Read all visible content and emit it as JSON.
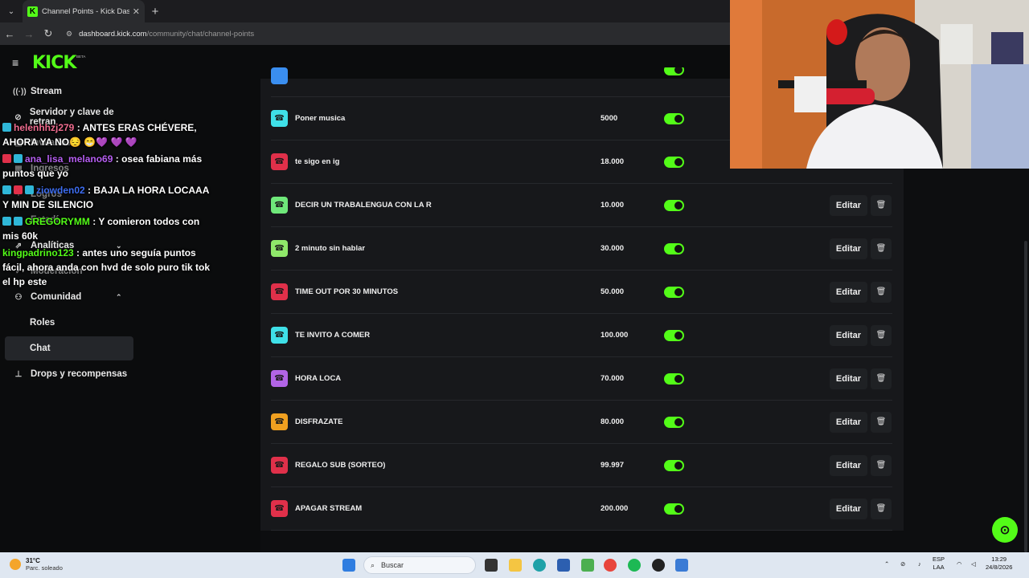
{
  "browser": {
    "tab_title": "Channel Points - Kick Dashboar",
    "tab_close": "✕",
    "new_tab": "+",
    "url_host": "dashboard.kick.com",
    "url_path": "/community/chat/channel-points"
  },
  "sidebar": {
    "logo": "KICK",
    "beta": "BETA",
    "items": [
      {
        "label": "Stream",
        "icon": "stream-icon"
      },
      {
        "label": "Servidor y clave de retran",
        "icon": "link-icon"
      },
      {
        "label": "Invitados",
        "icon": "guests-icon"
      },
      {
        "label": "Ingresos",
        "icon": "income-icon"
      },
      {
        "label": "Logros",
        "icon": "trophy-icon"
      },
      {
        "label": "Estadí",
        "icon": "stats-icon"
      },
      {
        "label": "Analíticas",
        "icon": "analytics-icon"
      },
      {
        "label": "Moderación",
        "icon": "moderation-icon"
      },
      {
        "label": "Comunidad",
        "icon": "community-icon"
      },
      {
        "label": "Roles",
        "icon": ""
      },
      {
        "label": "Chat",
        "icon": ""
      },
      {
        "label": "Drops y recompensas",
        "icon": "drops-icon"
      }
    ]
  },
  "chat_overlay": [
    {
      "user": "helenhhzj279",
      "text": ": ANTES ERAS CHÉVERE, AHORA YA NO😔 😁💜 💜 💜"
    },
    {
      "user": "ana_lisa_melano69",
      "text": ": osea fabiana más puntos que yo"
    },
    {
      "user": "ziowden02",
      "text": ": BAJA LA HORA LOCAAA Y MIN DE SILENCIO"
    },
    {
      "user": "GREGORYMM",
      "text": ": Y comieron todos con mis 60k"
    },
    {
      "user": "kingpadrino123",
      "text": ": antes uno seguía puntos fácil, ahora anda con hvd de solo puro tik tok el hp este"
    }
  ],
  "rewards": [
    {
      "name": "Poner musica",
      "cost": "5000",
      "color": "#3fe0e8",
      "enabled": true
    },
    {
      "name": "te sigo en ig",
      "cost": "18.000",
      "color": "#e0304a",
      "enabled": true
    },
    {
      "name": "DECIR UN TRABALENGUA CON LA R",
      "cost": "10.000",
      "color": "#6fe87a",
      "enabled": true
    },
    {
      "name": "2 minuto sin hablar",
      "cost": "30.000",
      "color": "#8fe86a",
      "enabled": true
    },
    {
      "name": "TIME OUT POR 30 MINUTOS",
      "cost": "50.000",
      "color": "#e0304a",
      "enabled": true
    },
    {
      "name": "TE INVITO A COMER",
      "cost": "100.000",
      "color": "#3fe0e8",
      "enabled": true
    },
    {
      "name": "HORA LOCA",
      "cost": "70.000",
      "color": "#b264e6",
      "enabled": true
    },
    {
      "name": "DISFRAZATE",
      "cost": "80.000",
      "color": "#f0a020",
      "enabled": true
    },
    {
      "name": "REGALO SUB (SORTEO)",
      "cost": "99.997",
      "color": "#e0304a",
      "enabled": true
    },
    {
      "name": "APAGAR STREAM",
      "cost": "200.000",
      "color": "#e0304a",
      "enabled": true
    }
  ],
  "edit_label": "Editar",
  "taskbar": {
    "temp": "31°C",
    "weather": "Parc. soleado",
    "search_placeholder": "Buscar",
    "lang1": "ESP",
    "lang2": "LAA",
    "time": "13:29",
    "date": "24/8/2026"
  }
}
